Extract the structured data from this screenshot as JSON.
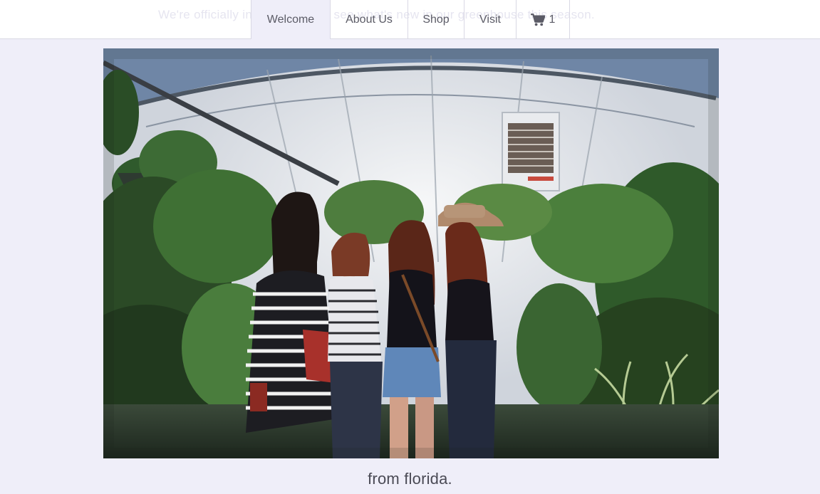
{
  "topbar": {
    "ghost_text": "We're officially in bloom! Come see what's new in our greenhouse this season."
  },
  "nav": {
    "items": [
      {
        "label": "Welcome",
        "active": true
      },
      {
        "label": "About Us",
        "active": false
      },
      {
        "label": "Shop",
        "active": false
      },
      {
        "label": "Visit",
        "active": false
      }
    ],
    "cart": {
      "icon": "shopping-cart-icon",
      "count": "1"
    }
  },
  "hero": {
    "alt": "Four friends laughing together inside a plant greenhouse"
  },
  "caption": "from florida.",
  "colors": {
    "page_background": "#efeef9",
    "nav_active": "#efeef9",
    "border": "#d9d8e4",
    "text": "#5b5b66"
  }
}
